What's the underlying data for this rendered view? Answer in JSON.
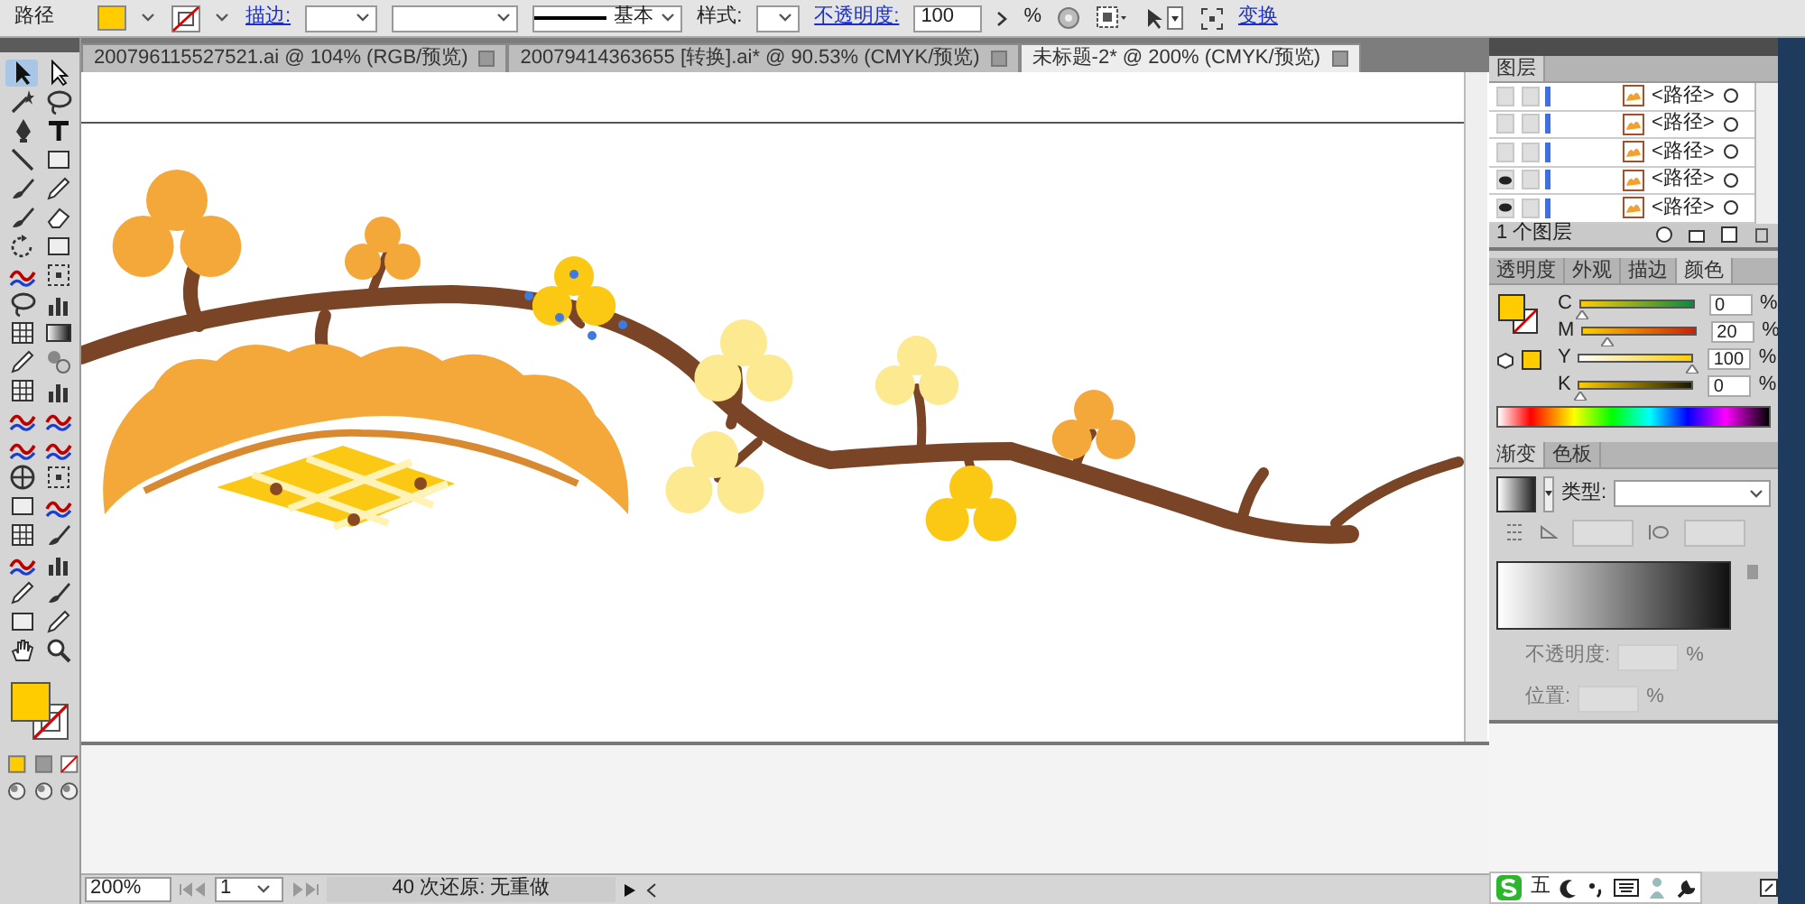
{
  "control_bar": {
    "object_type": "路径",
    "stroke_label": "描边:",
    "stroke_profile": "基本",
    "style_label": "样式:",
    "opacity_label": "不透明度:",
    "opacity_value": "100",
    "opacity_unit": "%",
    "transform_label": "变换"
  },
  "document_tabs": [
    {
      "title": "200796115527521.ai @ 104% (RGB/预览)",
      "selected": false
    },
    {
      "title": "20079414363655 [转换].ai* @ 90.53% (CMYK/预览)",
      "selected": false
    },
    {
      "title": "未标题-2* @ 200% (CMYK/预览)",
      "selected": true
    }
  ],
  "tools": [
    {
      "kind": "pointer",
      "selected": true
    },
    {
      "kind": "hollow-pointer",
      "selected": false
    },
    {
      "kind": "wand",
      "selected": false
    },
    {
      "kind": "lasso",
      "selected": false
    },
    {
      "kind": "pen",
      "selected": false
    },
    {
      "kind": "letter-t",
      "selected": false
    },
    {
      "kind": "line",
      "selected": false
    },
    {
      "kind": "square",
      "selected": false
    },
    {
      "kind": "brush",
      "selected": false
    },
    {
      "kind": "pencil",
      "selected": false
    },
    {
      "kind": "brush",
      "selected": false
    },
    {
      "kind": "eraser",
      "selected": false
    },
    {
      "kind": "rotate",
      "selected": false
    },
    {
      "kind": "square",
      "selected": false
    },
    {
      "kind": "wave",
      "selected": false
    },
    {
      "kind": "dashed-square",
      "selected": false
    },
    {
      "kind": "lasso",
      "selected": false
    },
    {
      "kind": "bars",
      "selected": false
    },
    {
      "kind": "grid",
      "selected": false
    },
    {
      "kind": "gradient",
      "selected": false
    },
    {
      "kind": "pencil",
      "selected": false
    },
    {
      "kind": "circle",
      "selected": false
    },
    {
      "kind": "grid",
      "selected": false
    },
    {
      "kind": "bars",
      "selected": false
    },
    {
      "kind": "wave",
      "selected": false
    },
    {
      "kind": "wave",
      "selected": false
    },
    {
      "kind": "wave",
      "selected": false
    },
    {
      "kind": "wave",
      "selected": false
    },
    {
      "kind": "crosshair",
      "selected": false
    },
    {
      "kind": "dashed-square",
      "selected": false
    },
    {
      "kind": "square",
      "selected": false
    },
    {
      "kind": "wave",
      "selected": false
    },
    {
      "kind": "grid",
      "selected": false
    },
    {
      "kind": "brush",
      "selected": false
    },
    {
      "kind": "wave",
      "selected": false
    },
    {
      "kind": "bars",
      "selected": false
    },
    {
      "kind": "pencil",
      "selected": false
    },
    {
      "kind": "brush",
      "selected": false
    },
    {
      "kind": "square",
      "selected": false
    },
    {
      "kind": "pencil",
      "selected": false
    },
    {
      "kind": "hand",
      "selected": false
    },
    {
      "kind": "zoom",
      "selected": false
    }
  ],
  "layers_panel": {
    "title": "图层",
    "rows": [
      {
        "name": "<路径>",
        "visible": false
      },
      {
        "name": "<路径>",
        "visible": false
      },
      {
        "name": "<路径>",
        "visible": false
      },
      {
        "name": "<路径>",
        "visible": true
      },
      {
        "name": "<路径>",
        "visible": true
      }
    ],
    "footer": "1 个图层"
  },
  "color_panel": {
    "tabs": [
      {
        "label": "透明度",
        "selected": false
      },
      {
        "label": "外观",
        "selected": false
      },
      {
        "label": "描边",
        "selected": false
      },
      {
        "label": "颜色",
        "selected": true
      }
    ],
    "channels": [
      {
        "name": "C",
        "level": 0,
        "value": "0",
        "unit": "%"
      },
      {
        "name": "M",
        "level": 0.2,
        "value": "20",
        "unit": "%"
      },
      {
        "name": "Y",
        "level": 1,
        "value": "100",
        "unit": "%"
      },
      {
        "name": "K",
        "level": 0,
        "value": "0",
        "unit": "%"
      }
    ]
  },
  "gradient_panel": {
    "tabs": [
      {
        "label": "渐变",
        "selected": true
      },
      {
        "label": "色板",
        "selected": false
      }
    ],
    "type_label": "类型:",
    "opacity_label": "不透明度:",
    "opacity_unit": "%",
    "location_label": "位置:",
    "location_unit": "%"
  },
  "status_bar": {
    "zoom": "200%",
    "artboard": "1",
    "history": "40 次还原: 无重做"
  },
  "ime_bar": {
    "label": "五"
  }
}
